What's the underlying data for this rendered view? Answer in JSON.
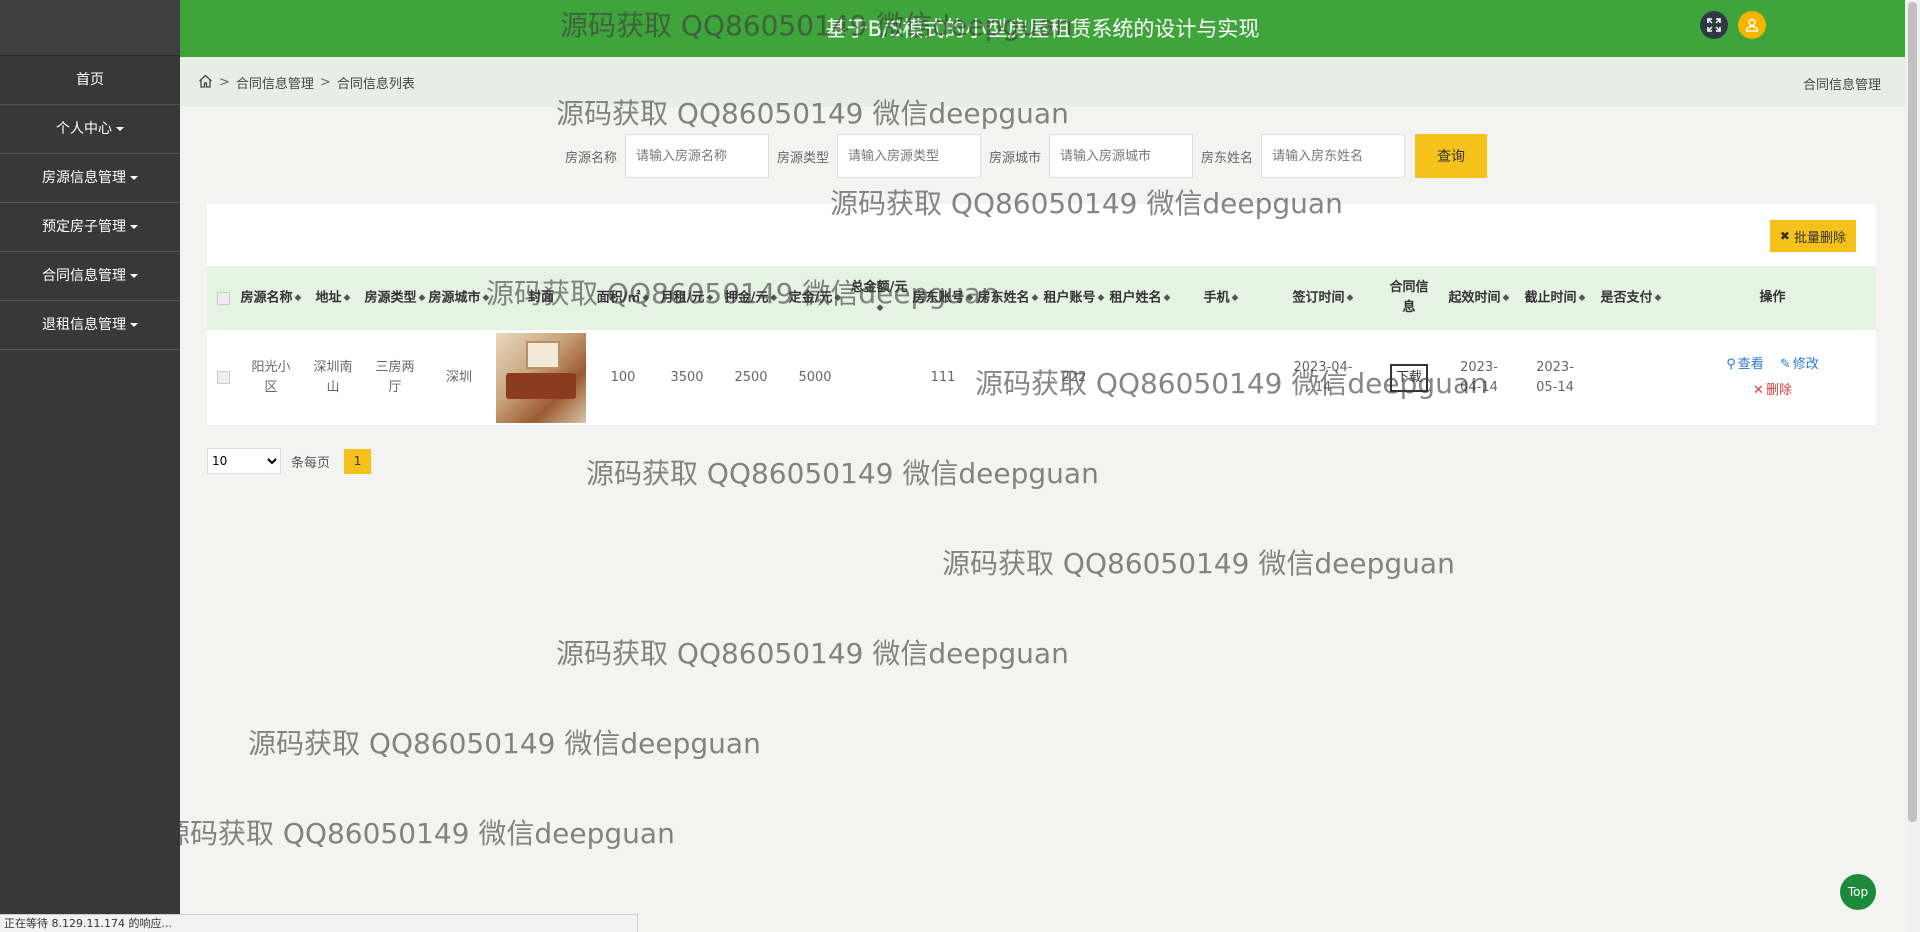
{
  "app": {
    "title": "基于B/S模式的小型房屋租赁系统的设计与实现"
  },
  "sidebar": {
    "items": [
      {
        "label": "首页"
      },
      {
        "label": "个人中心"
      },
      {
        "label": "房源信息管理"
      },
      {
        "label": "预定房子管理"
      },
      {
        "label": "合同信息管理"
      },
      {
        "label": "退租信息管理"
      }
    ]
  },
  "breadcrumb": {
    "level1": "合同信息管理",
    "level2": "合同信息列表",
    "sep": ">",
    "right": "合同信息管理"
  },
  "search": {
    "name_label": "房源名称",
    "name_placeholder": "请输入房源名称",
    "type_label": "房源类型",
    "type_placeholder": "请输入房源类型",
    "city_label": "房源城市",
    "city_placeholder": "请输入房源城市",
    "owner_label": "房东姓名",
    "owner_placeholder": "请输入房东姓名",
    "query_label": "查询"
  },
  "toolbar": {
    "batch_delete_label": "批量删除"
  },
  "table": {
    "headers": [
      "房源名称",
      "地址",
      "房源类型",
      "房源城市",
      "封面",
      "面积/㎡",
      "月租/元",
      "押金/元",
      "定金/元",
      "总金额/元",
      "房东账号",
      "房东姓名",
      "租户账号",
      "租户姓名",
      "手机",
      "签订时间",
      "合同信息",
      "起效时间",
      "截止时间",
      "是否支付",
      "操作"
    ],
    "row": {
      "name": "阳光小区",
      "address": "深圳南山",
      "type": "三房两厅",
      "city": "深圳",
      "area": "100",
      "rent": "3500",
      "deposit": "2500",
      "earnest": "5000",
      "total": "",
      "owner_account": "111",
      "owner_name": "",
      "tenant_account": "222",
      "tenant_name": "",
      "phone": "",
      "sign_time": "2023-04-14",
      "contract_label": "下载",
      "start_time": "2023-04-14",
      "end_time": "2023-05-14",
      "paid": "",
      "view_label": "查看",
      "edit_label": "修改",
      "delete_label": "删除"
    }
  },
  "pager": {
    "page_size": "10",
    "per_page_label": "条每页",
    "current_page": "1"
  },
  "watermark": {
    "text": "源码获取 QQ86050149 微信deepguan"
  },
  "status_bar": {
    "text": "正在等待 8.129.11.174 的响应..."
  },
  "back_to_top": {
    "label": "Top"
  },
  "colors": {
    "header_green": "#3fa43b",
    "sidebar": "#383838",
    "accent_yellow": "#f5c21b",
    "link_blue": "#2a7ad3",
    "delete_red": "#e23d3d"
  }
}
